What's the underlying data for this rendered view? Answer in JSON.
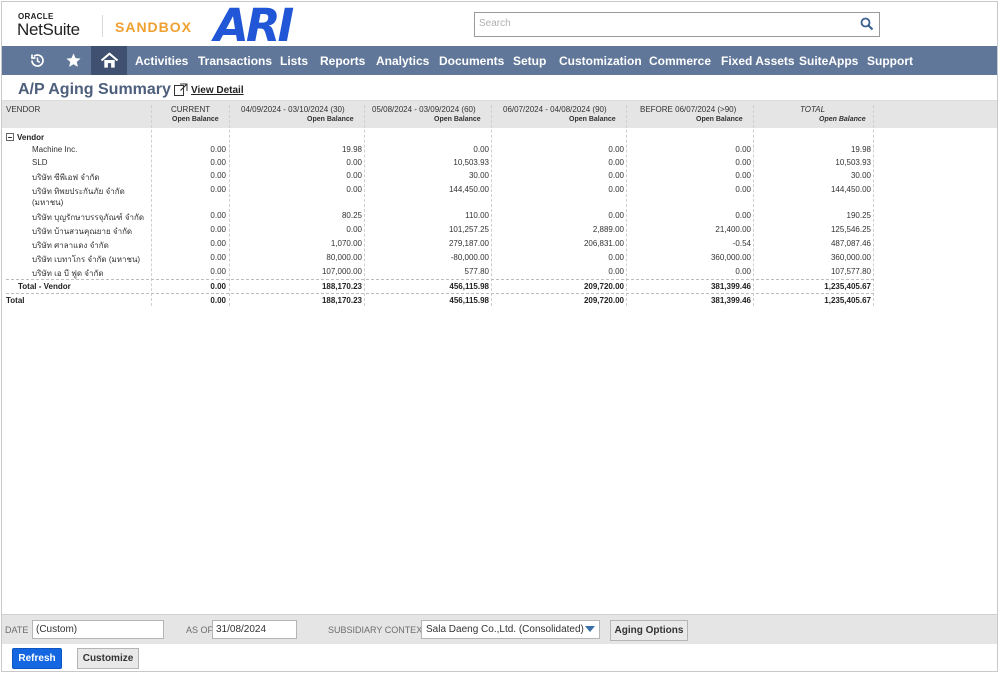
{
  "header": {
    "oracle": "ORACLE",
    "product": "NetSuite",
    "environment": "SANDBOX",
    "company_logo": "ARI",
    "search_placeholder": "Search"
  },
  "nav": {
    "items": [
      "Activities",
      "Transactions",
      "Lists",
      "Reports",
      "Analytics",
      "Documents",
      "Setup",
      "Customization",
      "Commerce",
      "Fixed Assets",
      "SuiteApps",
      "Support"
    ]
  },
  "report": {
    "title": "A/P Aging Summary",
    "view_detail": "View Detail",
    "columns": {
      "vendor": "VENDOR",
      "current": "CURRENT",
      "b30": "04/09/2024 - 03/10/2024 (30)",
      "b60": "05/08/2024 - 03/09/2024 (60)",
      "b90": "06/07/2024 - 04/08/2024 (90)",
      "before": "BEFORE 06/07/2024 (>90)",
      "total": "TOTAL",
      "open_balance": "Open Balance"
    },
    "group": "Vendor",
    "rows": [
      {
        "name": "Machine Inc.",
        "name2": "",
        "v": [
          "0.00",
          "19.98",
          "0.00",
          "0.00",
          "0.00",
          "19.98"
        ]
      },
      {
        "name": "SLD",
        "name2": "",
        "v": [
          "0.00",
          "0.00",
          "10,503.93",
          "0.00",
          "0.00",
          "10,503.93"
        ]
      },
      {
        "name": "บริษัท ซีพีเอฟ จำกัด",
        "name2": "",
        "v": [
          "0.00",
          "0.00",
          "30.00",
          "0.00",
          "0.00",
          "30.00"
        ]
      },
      {
        "name": "บริษัท ทิพยประกันภัย จำกัด",
        "name2": "(มหาชน)",
        "v": [
          "0.00",
          "0.00",
          "144,450.00",
          "0.00",
          "0.00",
          "144,450.00"
        ]
      },
      {
        "name": "บริษัท บุญรักษาบรรจุภัณฑ์ จำกัด",
        "name2": "",
        "v": [
          "0.00",
          "80.25",
          "110.00",
          "0.00",
          "0.00",
          "190.25"
        ]
      },
      {
        "name": "บริษัท บ้านสวนคุณยาย จำกัด",
        "name2": "",
        "v": [
          "0.00",
          "0.00",
          "101,257.25",
          "2,889.00",
          "21,400.00",
          "125,546.25"
        ]
      },
      {
        "name": "บริษัท ศาลาแดง จำกัด",
        "name2": "",
        "v": [
          "0.00",
          "1,070.00",
          "279,187.00",
          "206,831.00",
          "-0.54",
          "487,087.46"
        ]
      },
      {
        "name": "บริษัท เบทาโกร จำกัด (มหาชน)",
        "name2": "",
        "v": [
          "0.00",
          "80,000.00",
          "-80,000.00",
          "0.00",
          "360,000.00",
          "360,000.00"
        ]
      },
      {
        "name": "บริษัท เอ บี ฟูด จำกัด",
        "name2": "",
        "v": [
          "0.00",
          "107,000.00",
          "577.80",
          "0.00",
          "0.00",
          "107,577.80"
        ]
      }
    ],
    "total_vendor": {
      "label": "Total - Vendor",
      "v": [
        "0.00",
        "188,170.23",
        "456,115.98",
        "209,720.00",
        "381,399.46",
        "1,235,405.67"
      ]
    },
    "total": {
      "label": "Total",
      "v": [
        "0.00",
        "188,170.23",
        "456,115.98",
        "209,720.00",
        "381,399.46",
        "1,235,405.67"
      ]
    }
  },
  "footer": {
    "date_label": "DATE",
    "date_value": "(Custom)",
    "as_of_label": "AS OF",
    "as_of_value": "31/08/2024",
    "subsidiary_label": "SUBSIDIARY CONTEXT",
    "subsidiary_value": "Sala Daeng Co.,Ltd. (Consolidated)",
    "aging_options": "Aging Options",
    "refresh": "Refresh",
    "customize": "Customize"
  },
  "colors": {
    "nav_bg": "#607799",
    "nav_active": "#3f5070",
    "title": "#4d5f7c",
    "sandbox": "#f0a030",
    "logo": "#2157d6",
    "primary_button": "#1467e0"
  }
}
